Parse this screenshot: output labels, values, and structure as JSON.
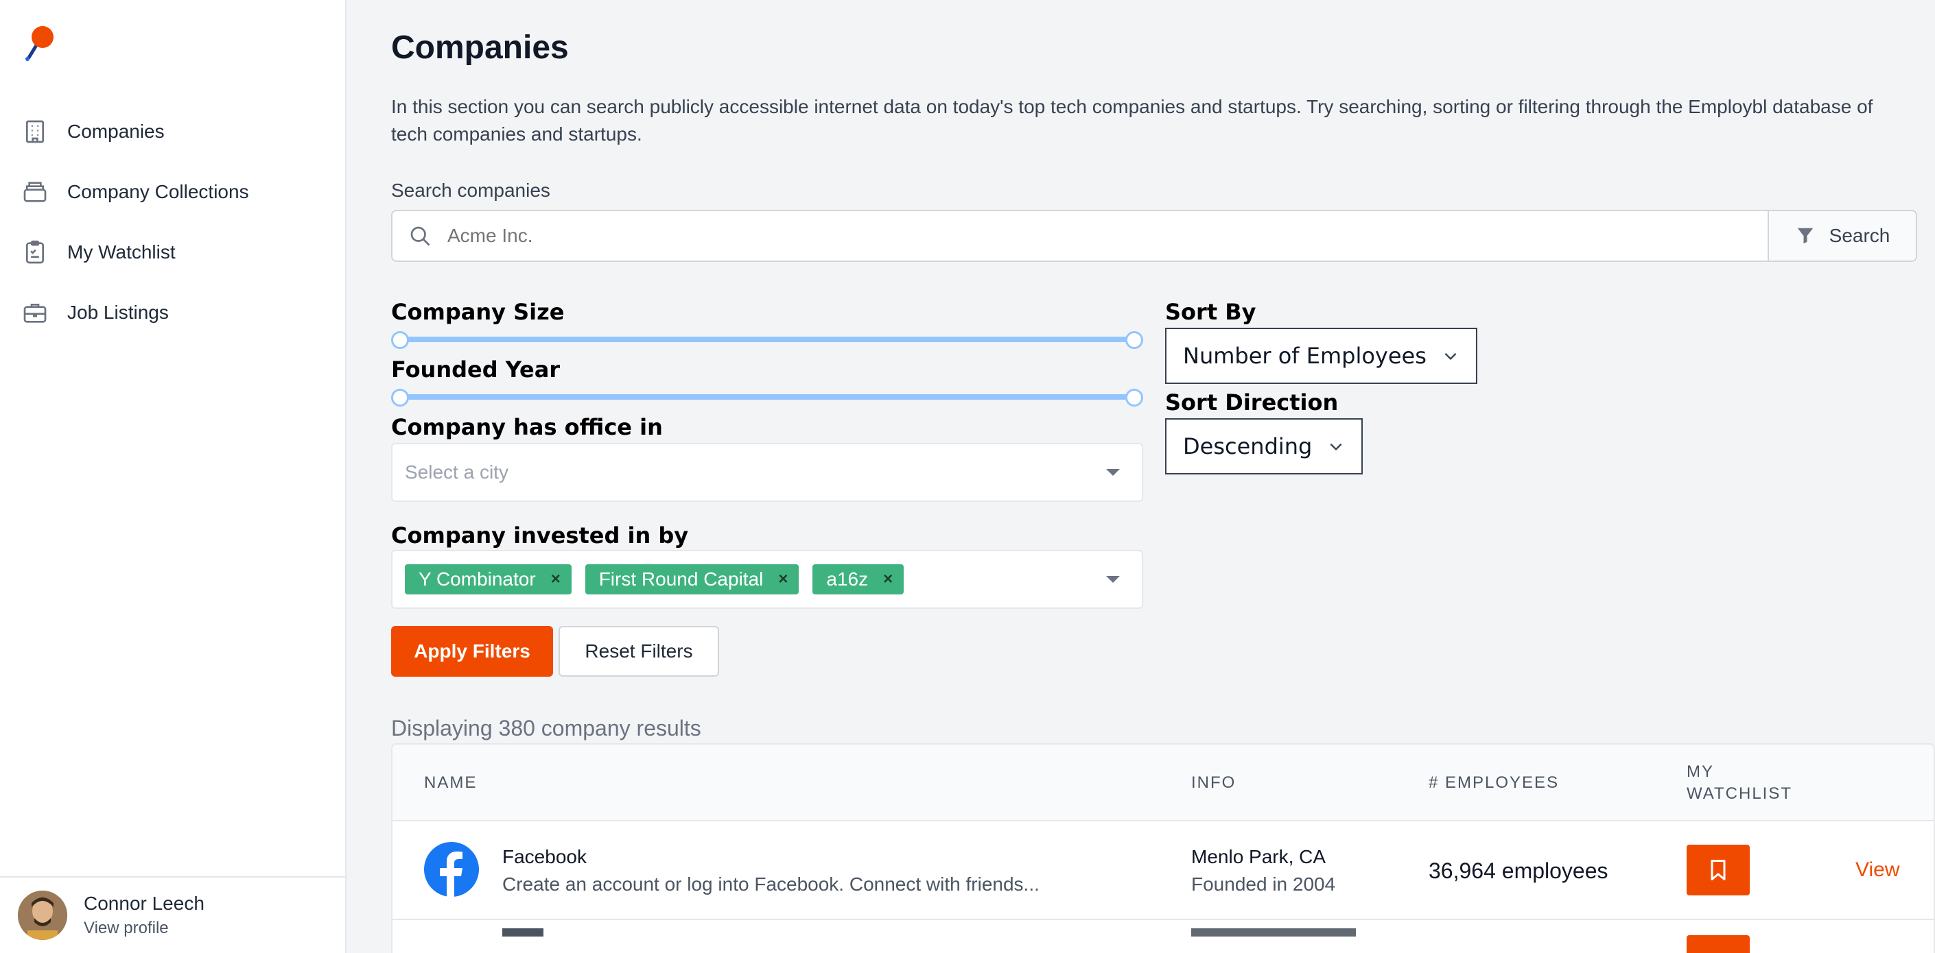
{
  "app": {
    "brand_color": "#f04a00",
    "logo_icon": "pin-logo-icon"
  },
  "sidebar": {
    "items": [
      {
        "label": "Companies",
        "icon": "building-icon"
      },
      {
        "label": "Company Collections",
        "icon": "collection-icon"
      },
      {
        "label": "My Watchlist",
        "icon": "clipboard-icon"
      },
      {
        "label": "Job Listings",
        "icon": "briefcase-icon"
      }
    ],
    "profile": {
      "name": "Connor Leech",
      "link": "View profile"
    }
  },
  "main": {
    "title": "Companies",
    "description": "In this section you can search publicly accessible internet data on today's top tech companies and startups. Try searching, sorting or filtering through the Employbl database of tech companies and startups.",
    "search": {
      "label": "Search companies",
      "placeholder": "Acme Inc.",
      "button": "Search"
    },
    "filters": {
      "company_size_label": "Company Size",
      "founded_year_label": "Founded Year",
      "office_label": "Company has office in",
      "office_placeholder": "Select a city",
      "invested_label": "Company invested in by",
      "investors": [
        "Y Combinator",
        "First Round Capital",
        "a16z"
      ],
      "tag_remove": "×",
      "slider_color": "#93c5fd",
      "tag_color": "#3fb37f"
    },
    "sort": {
      "by_label": "Sort By",
      "by_value": "Number of Employees",
      "direction_label": "Sort Direction",
      "direction_value": "Descending"
    },
    "actions": {
      "apply": "Apply Filters",
      "reset": "Reset Filters"
    },
    "results_text": "Displaying 380 company results",
    "table": {
      "headers": {
        "name": "NAME",
        "info": "INFO",
        "employees": "# EMPLOYEES",
        "watchlist_line1": "MY",
        "watchlist_line2": "WATCHLIST"
      },
      "rows": [
        {
          "name": "Facebook",
          "description": "Create an account or log into Facebook. Connect with friends...",
          "location": "Menlo Park, CA",
          "founded": "Founded in 2004",
          "employees": "36,964 employees",
          "view": "View",
          "logo_icon": "facebook-icon",
          "watch_icon": "bookmark-icon"
        }
      ]
    }
  }
}
